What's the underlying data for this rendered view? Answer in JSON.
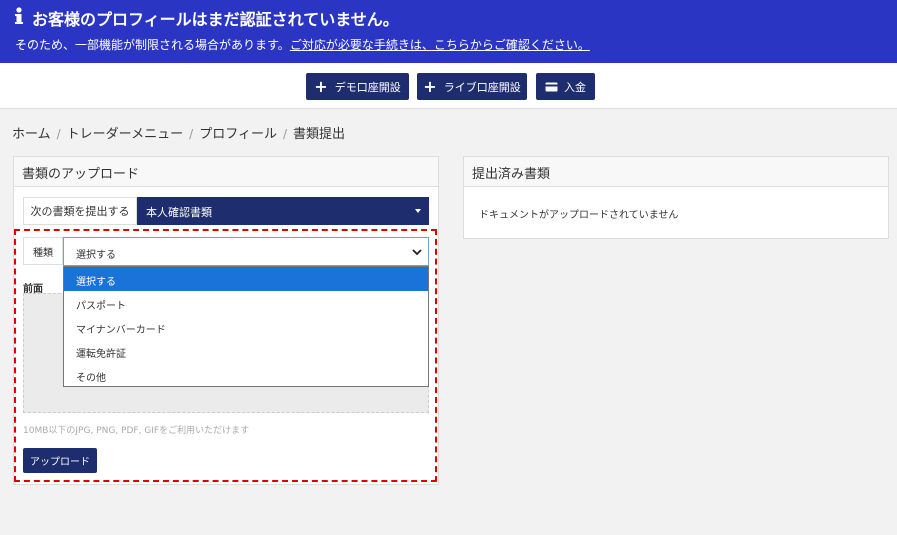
{
  "banner": {
    "title": "お客様のプロフィールはまだ認証されていません。",
    "sub_text": "そのため、一部機能が制限される場合があります。",
    "sub_link": "ご対応が必要な手続きは、こちらからご確認ください。"
  },
  "toolbar": {
    "demo_label": "デモ口座開設",
    "live_label": "ライブ口座開設",
    "deposit_label": "入金"
  },
  "breadcrumb": [
    "ホーム",
    "トレーダーメニュー",
    "プロフィール",
    "書類提出"
  ],
  "upload_panel": {
    "title": "書類のアップロード",
    "doc_label": "次の書類を提出する",
    "doc_value": "本人確認書類",
    "type_label": "種類",
    "type_value": "選択する",
    "front_label": "前面",
    "options": [
      "選択する",
      "パスポート",
      "マイナンバーカード",
      "運転免許証",
      "その他"
    ],
    "hint": "10MB以下のJPG, PNG, PDF, GIFをご利用いただけます",
    "upload_label": "アップロード"
  },
  "submitted_panel": {
    "title": "提出済み書類",
    "empty": "ドキュメントがアップロードされていません"
  },
  "colors": {
    "banner": "#2b35c4",
    "button": "#1e2d6e",
    "highlight": "#e00000",
    "option_selected": "#1a73d9"
  }
}
